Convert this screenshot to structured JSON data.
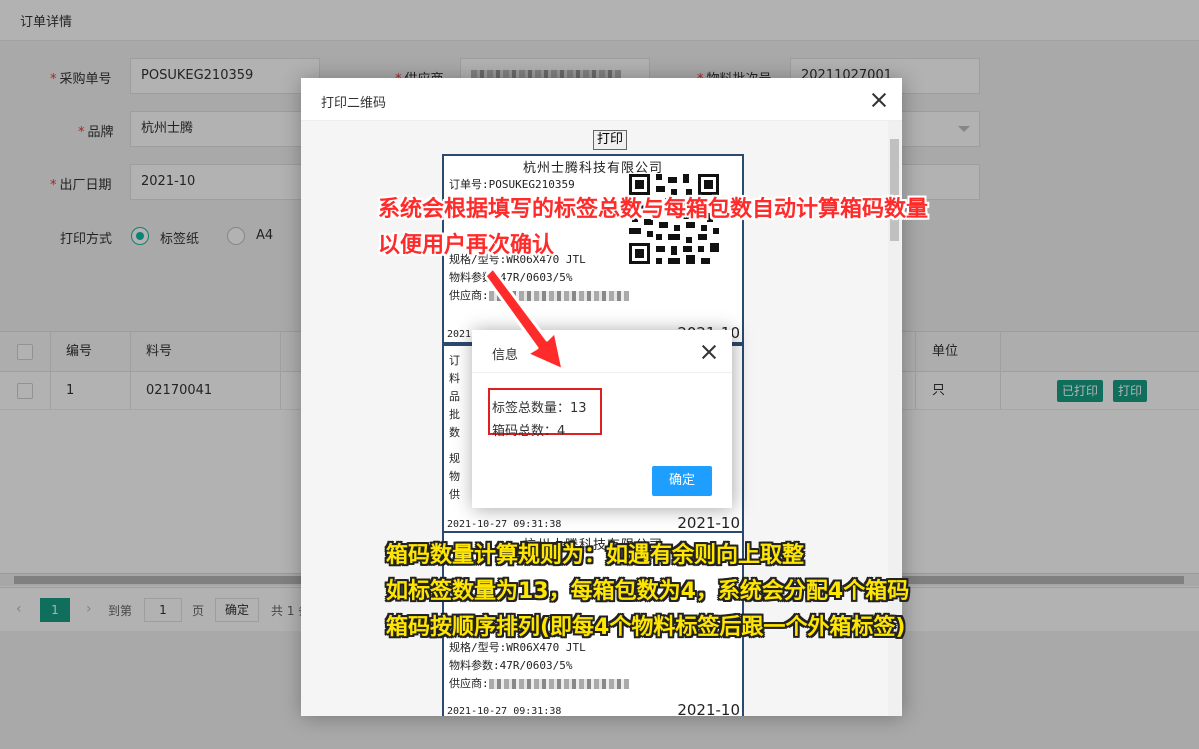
{
  "page": {
    "title": "订单详情"
  },
  "form": {
    "po_label": "采购单号",
    "po_value": "POSUKEG210359",
    "supplier_label": "供应商",
    "batch_label": "物料批次号",
    "batch_value": "20211027001",
    "brand_label": "品牌",
    "brand_value": "杭州士腾",
    "date_label": "出厂日期",
    "date_value": "2021-10",
    "print_mode_label": "打印方式",
    "print_mode_options": [
      "标签纸",
      "A4"
    ],
    "print_mode_selected": "标签纸"
  },
  "table": {
    "headers": [
      "编号",
      "料号",
      "单位"
    ],
    "rows": [
      {
        "no": "1",
        "part_no": "02170041",
        "unit": "只",
        "actions": [
          "已打印",
          "打印"
        ]
      }
    ]
  },
  "pager": {
    "current": "1",
    "goto_label": "到第",
    "goto_value": "1",
    "page_unit": "页",
    "confirm": "确定",
    "total_prefix": "共 1 条"
  },
  "print_dialog": {
    "title": "打印二维码",
    "print_button": "打印",
    "labels": [
      {
        "company": "杭州士腾科技有限公司",
        "order": "订单号:POSUKEG210359",
        "spec": "规格/型号:WR06X470 JTL",
        "params": "物料参数:47R/0603/5%",
        "supplier": "供应商:",
        "datetime": "2021-10-27 09:31:38",
        "big": "2021-10"
      },
      {
        "lines": [
          "订",
          "料",
          "品",
          "批",
          "数",
          "规",
          "物",
          "供"
        ],
        "datetime": "2021-10-27 09:31:38",
        "big": "2021-10"
      },
      {
        "company": "杭州士腾科技有限公司",
        "spec": "规格/型号:WR06X470 JTL",
        "params": "物料参数:47R/0603/5%",
        "supplier": "供应商:",
        "datetime": "2021-10-27 09:31:38",
        "big": "2021-10"
      }
    ]
  },
  "info_dialog": {
    "title": "信息",
    "label_total": "标签总数量：13",
    "box_total": "箱码总数：4",
    "ok": "确定"
  },
  "annotations": {
    "red_line1": "系统会根据填写的标签总数与每箱包数自动计算箱码数量",
    "red_line2": "以便用户再次确认",
    "yellow_line1": "箱码数量计算规则为：如遇有余则向上取整",
    "yellow_line2": "如标签数量为13，每箱包数为4，系统会分配4个箱码",
    "yellow_line3": "箱码按顺序排列(即每4个物料标签后跟一个外箱标签)"
  },
  "colors": {
    "accent": "#16a085",
    "primary_btn": "#1e9fff",
    "highlight": "#e02020",
    "label_border": "#2b4a6f"
  }
}
